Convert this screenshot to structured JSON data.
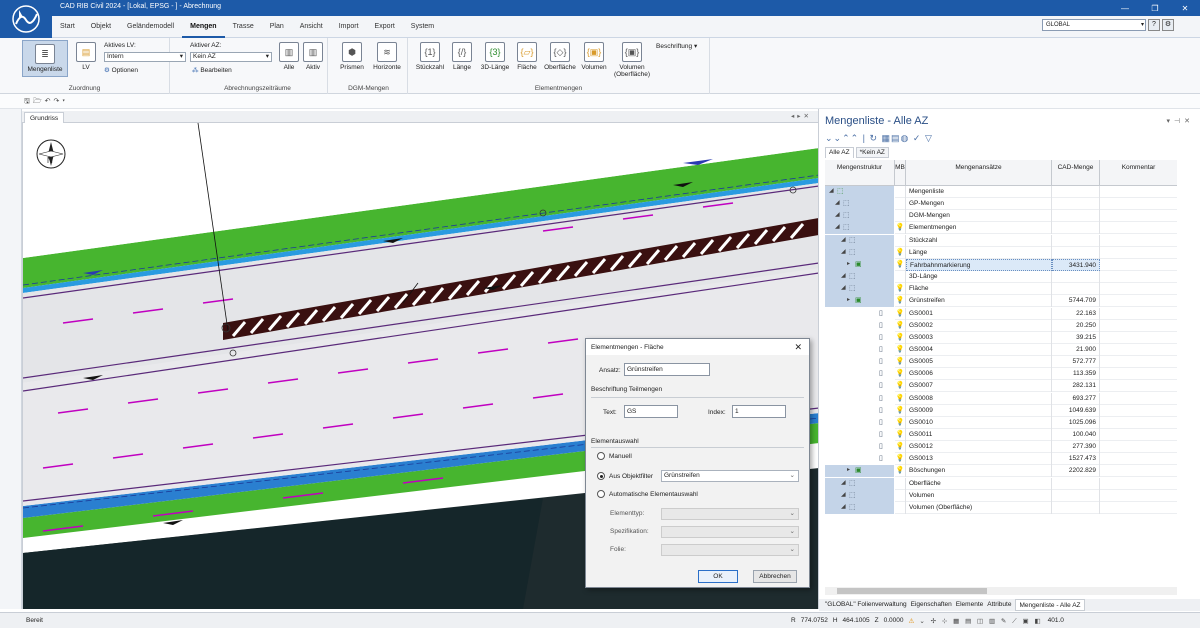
{
  "app": {
    "title": "CAD RIB Civil 2024 - [Lokal, EPSG - ] - Abrechnung",
    "window_buttons": [
      "—",
      "❐",
      "✕"
    ],
    "global_select": "GLOBAL"
  },
  "ribbon_tabs": [
    "Start",
    "Objekt",
    "Geländemodell",
    "Mengen",
    "Trasse",
    "Plan",
    "Ansicht",
    "Import",
    "Export",
    "System"
  ],
  "active_tab": "Mengen",
  "ribbon": {
    "mengenliste": "Mengenliste",
    "lv": "LV",
    "aktives_lv_label": "Aktives LV:",
    "aktives_lv_value": "Intern",
    "optionen": "Optionen",
    "zuordnung": "Zuordnung",
    "aktiver_az_label": "Aktiver AZ:",
    "aktiver_az_value": "Kein AZ",
    "bearbeiten": "Bearbeiten",
    "alle": "Alle",
    "aktiv": "Aktiv",
    "abrechnungszeitraeume": "Abrechnungszeiträume",
    "prismen": "Prismen",
    "horizonte": "Horizonte",
    "dgm_mengen": "DGM-Mengen",
    "stueckzahl": "Stückzahl",
    "laenge": "Länge",
    "laenge3d": "3D-Länge",
    "flaeche": "Fläche",
    "oberflaeche": "Oberfläche",
    "volumen": "Volumen",
    "volumen_of1": "Volumen",
    "volumen_of2": "(Oberfläche)",
    "beschriftung": "Beschriftung",
    "elementmengen": "Elementmengen"
  },
  "doc": {
    "tab": "Grundriss",
    "compass": "N"
  },
  "dialog": {
    "title": "Elementmengen - Fläche",
    "ansatz_label": "Ansatz:",
    "ansatz_value": "Grünstreifen",
    "beschriftung_header": "Beschriftung Teilmengen",
    "text_label": "Text:",
    "text_value": "GS",
    "index_label": "Index:",
    "index_value": "1",
    "elementauswahl_header": "Elementauswahl",
    "manuell": "Manuell",
    "aus_objektfilter": "Aus Objektfilter",
    "objektfilter_value": "Grünstreifen",
    "automatische": "Automatische Elementauswahl",
    "elementtyp_label": "Elementtyp:",
    "spezifikation_label": "Spezifikation:",
    "folie_label": "Folie:",
    "ok": "OK",
    "abbrechen": "Abbrechen"
  },
  "panel": {
    "title": "Mengenliste - Alle AZ",
    "tabs": [
      "Alle AZ",
      "*Kein AZ"
    ],
    "headers": [
      "Mengenstruktur",
      "MB",
      "Mengenansätze",
      "CAD-Menge",
      "Kommentar"
    ],
    "rows": [
      {
        "name": "Mengenliste",
        "value": "",
        "bulb": false,
        "level": 0
      },
      {
        "name": "GP-Mengen",
        "value": "",
        "bulb": false,
        "level": 1
      },
      {
        "name": "DGM-Mengen",
        "value": "",
        "bulb": false,
        "level": 1
      },
      {
        "name": "Elementmengen",
        "value": "",
        "bulb": true,
        "level": 1
      },
      {
        "name": "Stückzahl",
        "value": "",
        "bulb": false,
        "level": 2
      },
      {
        "name": "Länge",
        "value": "",
        "bulb": true,
        "level": 2
      },
      {
        "name": "Fahrbahnmarkierung",
        "value": "3431.940",
        "bulb": true,
        "level": 3,
        "selected": true
      },
      {
        "name": "3D-Länge",
        "value": "",
        "bulb": false,
        "level": 2
      },
      {
        "name": "Fläche",
        "value": "",
        "bulb": true,
        "level": 2
      },
      {
        "name": "Grünstreifen",
        "value": "5744.709",
        "bulb": true,
        "level": 3
      },
      {
        "name": "GS0001",
        "value": "22.163",
        "bulb": true,
        "level": 4
      },
      {
        "name": "GS0002",
        "value": "20.250",
        "bulb": true,
        "level": 4
      },
      {
        "name": "GS0003",
        "value": "39.215",
        "bulb": true,
        "level": 4
      },
      {
        "name": "GS0004",
        "value": "21.900",
        "bulb": true,
        "level": 4
      },
      {
        "name": "GS0005",
        "value": "572.777",
        "bulb": true,
        "level": 4
      },
      {
        "name": "GS0006",
        "value": "113.359",
        "bulb": true,
        "level": 4
      },
      {
        "name": "GS0007",
        "value": "282.131",
        "bulb": true,
        "level": 4
      },
      {
        "name": "GS0008",
        "value": "693.277",
        "bulb": true,
        "level": 4
      },
      {
        "name": "GS0009",
        "value": "1049.639",
        "bulb": true,
        "level": 4
      },
      {
        "name": "GS0010",
        "value": "1025.096",
        "bulb": true,
        "level": 4
      },
      {
        "name": "GS0011",
        "value": "100.040",
        "bulb": true,
        "level": 4
      },
      {
        "name": "GS0012",
        "value": "277.390",
        "bulb": true,
        "level": 4
      },
      {
        "name": "GS0013",
        "value": "1527.473",
        "bulb": true,
        "level": 4
      },
      {
        "name": "Böschungen",
        "value": "2202.829",
        "bulb": true,
        "level": 3
      },
      {
        "name": "Oberfläche",
        "value": "",
        "bulb": false,
        "level": 2
      },
      {
        "name": "Volumen",
        "value": "",
        "bulb": false,
        "level": 2
      },
      {
        "name": "Volumen (Oberfläche)",
        "value": "",
        "bulb": false,
        "level": 2
      }
    ],
    "bottom_tabs": [
      "\"GLOBAL\" Folienverwaltung",
      "Eigenschaften",
      "Elemente",
      "Attribute",
      "Mengenliste - Alle AZ"
    ]
  },
  "statusbar": {
    "left": "Bereit",
    "r_label": "R",
    "r_value": "774.0752",
    "h_label": "H",
    "h_value": "464.1005",
    "z_label": "Z",
    "z_value": "0.0000",
    "zoom": "401.0"
  }
}
